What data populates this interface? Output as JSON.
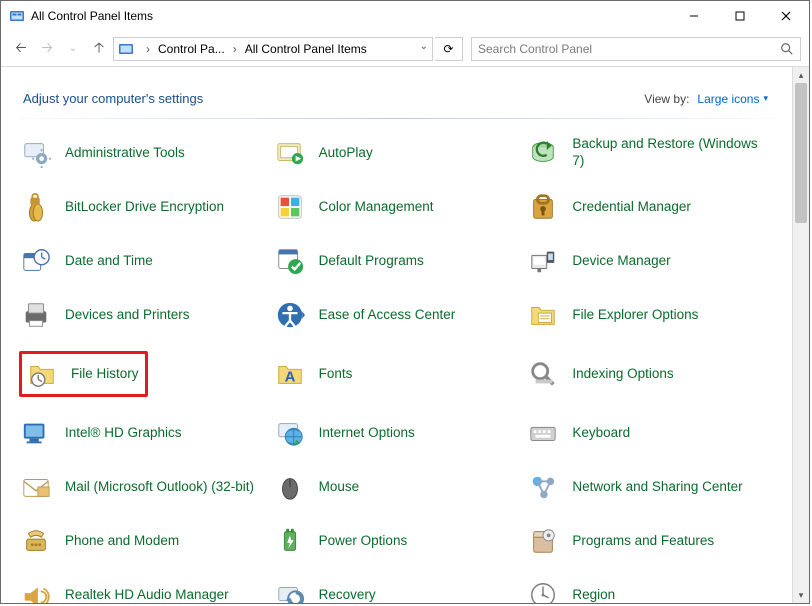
{
  "window": {
    "title": "All Control Panel Items"
  },
  "nav": {
    "breadcrumb_seg1": "Control Pa...",
    "breadcrumb_seg2": "All Control Panel Items",
    "search_placeholder": "Search Control Panel"
  },
  "header": {
    "heading": "Adjust your computer's settings",
    "viewby_label": "View by:",
    "viewby_value": "Large icons"
  },
  "items": [
    {
      "label": "Administrative Tools",
      "icon": "admin-tools-icon"
    },
    {
      "label": "AutoPlay",
      "icon": "autoplay-icon"
    },
    {
      "label": "Backup and Restore (Windows 7)",
      "icon": "backup-restore-icon"
    },
    {
      "label": "BitLocker Drive Encryption",
      "icon": "bitlocker-icon"
    },
    {
      "label": "Color Management",
      "icon": "color-management-icon"
    },
    {
      "label": "Credential Manager",
      "icon": "credential-manager-icon"
    },
    {
      "label": "Date and Time",
      "icon": "date-time-icon"
    },
    {
      "label": "Default Programs",
      "icon": "default-programs-icon"
    },
    {
      "label": "Device Manager",
      "icon": "device-manager-icon"
    },
    {
      "label": "Devices and Printers",
      "icon": "devices-printers-icon"
    },
    {
      "label": "Ease of Access Center",
      "icon": "ease-access-icon"
    },
    {
      "label": "File Explorer Options",
      "icon": "file-explorer-options-icon"
    },
    {
      "label": "File History",
      "icon": "file-history-icon",
      "highlight": true
    },
    {
      "label": "Fonts",
      "icon": "fonts-icon"
    },
    {
      "label": "Indexing Options",
      "icon": "indexing-options-icon"
    },
    {
      "label": "Intel® HD Graphics",
      "icon": "intel-graphics-icon"
    },
    {
      "label": "Internet Options",
      "icon": "internet-options-icon"
    },
    {
      "label": "Keyboard",
      "icon": "keyboard-icon"
    },
    {
      "label": "Mail (Microsoft Outlook) (32-bit)",
      "icon": "mail-icon"
    },
    {
      "label": "Mouse",
      "icon": "mouse-icon"
    },
    {
      "label": "Network and Sharing Center",
      "icon": "network-sharing-icon"
    },
    {
      "label": "Phone and Modem",
      "icon": "phone-modem-icon"
    },
    {
      "label": "Power Options",
      "icon": "power-options-icon"
    },
    {
      "label": "Programs and Features",
      "icon": "programs-features-icon"
    },
    {
      "label": "Realtek HD Audio Manager",
      "icon": "realtek-audio-icon"
    },
    {
      "label": "Recovery",
      "icon": "recovery-icon"
    },
    {
      "label": "Region",
      "icon": "region-icon"
    }
  ],
  "colors": {
    "link_green": "#0b6b2c",
    "heading_blue": "#1a4e8b",
    "link_blue": "#0066cc",
    "highlight_red": "#e31b1b"
  }
}
